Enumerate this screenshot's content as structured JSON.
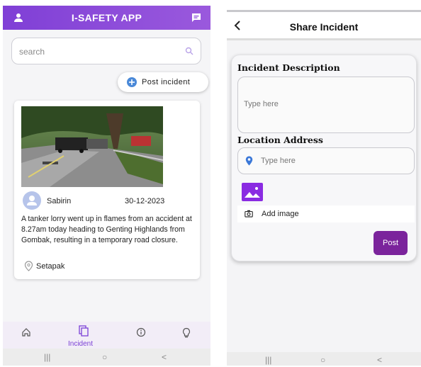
{
  "left": {
    "app_title": "I-SAFETY APP",
    "search": {
      "placeholder": "search"
    },
    "post_incident_label": "Post incident",
    "incident": {
      "user": "Sabirin",
      "date": "30-12-2023",
      "description": "A tanker lorry went up in flames from an accident at 8.27am today heading to Genting Highlands from Gombak, resulting in a temporary road closure.",
      "location": "Setapak"
    },
    "bottom_nav": [
      {
        "icon": "home-icon"
      },
      {
        "icon": "incident-icon",
        "label": "Incident",
        "active": true
      },
      {
        "icon": "info-icon"
      },
      {
        "icon": "lightbulb-icon"
      }
    ],
    "system_nav": [
      "|||",
      "○",
      "<"
    ]
  },
  "right": {
    "header_title": "Share Incident",
    "description_label": "Incident Description",
    "description_placeholder": "Type here",
    "location_label": "Location Address",
    "location_placeholder": "Type here",
    "add_image_label": "Add image",
    "post_label": "Post",
    "system_nav": [
      "|||",
      "○",
      "<"
    ]
  },
  "colors": {
    "accent": "#8a47db",
    "post_button": "#7b249c",
    "pin_blue": "#3b78d8"
  }
}
